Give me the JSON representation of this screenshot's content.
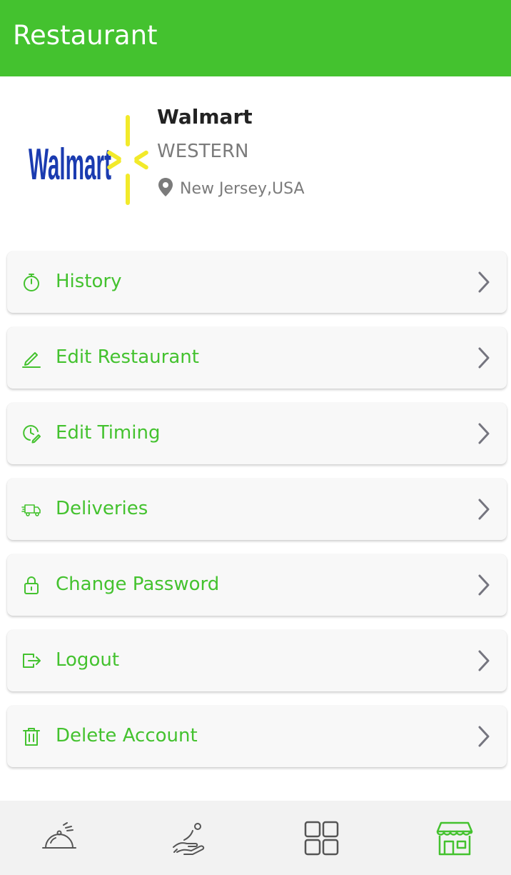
{
  "app_bar": {
    "title": "Restaurant"
  },
  "profile": {
    "logo_text": "Walmart",
    "name": "Walmart",
    "type": "WESTERN",
    "location": "New Jersey,USA"
  },
  "menu": {
    "items": [
      {
        "label": "History",
        "icon": "stopwatch-icon"
      },
      {
        "label": "Edit Restaurant",
        "icon": "pencil-icon"
      },
      {
        "label": "Edit Timing",
        "icon": "clock-edit-icon"
      },
      {
        "label": "Deliveries",
        "icon": "delivery-truck-icon"
      },
      {
        "label": "Change Password",
        "icon": "lock-icon"
      },
      {
        "label": "Logout",
        "icon": "logout-icon"
      },
      {
        "label": "Delete Account",
        "icon": "trash-icon"
      }
    ]
  },
  "bottom_nav": {
    "items": [
      {
        "icon": "food-cloche-icon",
        "active": false
      },
      {
        "icon": "hand-coin-icon",
        "active": false
      },
      {
        "icon": "grid-icon",
        "active": false
      },
      {
        "icon": "store-icon",
        "active": true
      }
    ]
  },
  "colors": {
    "accent": "#44c22f",
    "text_muted": "#7b7b7b",
    "chevron": "#75757f",
    "logo_blue": "#1a3bb0",
    "logo_spark": "#f2ea2a"
  }
}
